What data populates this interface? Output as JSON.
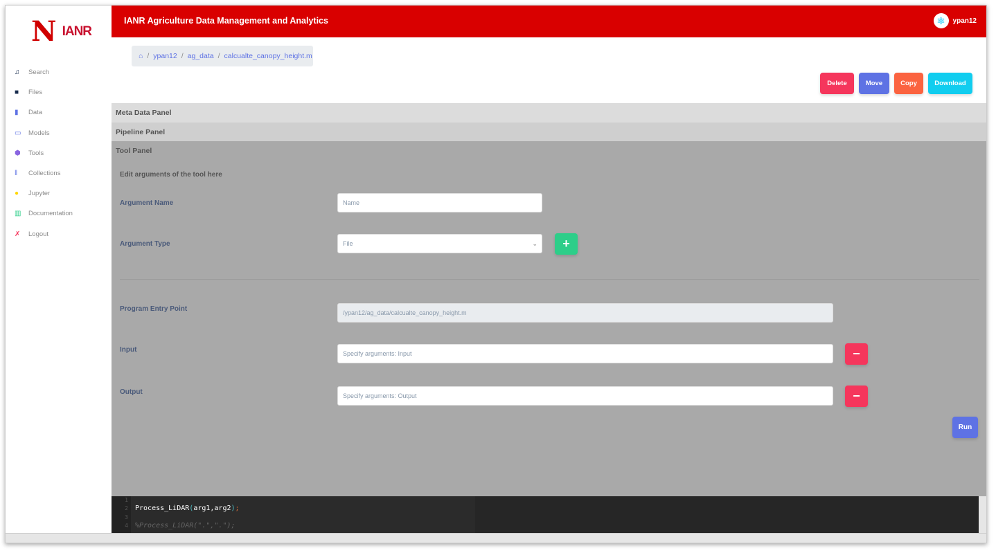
{
  "brand": {
    "logo_letter": "N",
    "logo_text": "IANR"
  },
  "sidebar": {
    "items": [
      {
        "label": "Search",
        "icon": "search-icon",
        "color": "#172b4d"
      },
      {
        "label": "Files",
        "icon": "files-icon",
        "color": "#172b4d"
      },
      {
        "label": "Data",
        "icon": "chart-bar-icon",
        "color": "#5e72e4"
      },
      {
        "label": "Models",
        "icon": "laptop-icon",
        "color": "#5e72e4"
      },
      {
        "label": "Tools",
        "icon": "box-icon",
        "color": "#8965e0"
      },
      {
        "label": "Collections",
        "icon": "collections-icon",
        "color": "#5e72e4"
      },
      {
        "label": "Jupyter",
        "icon": "user-icon",
        "color": "#ffd600"
      },
      {
        "label": "Documentation",
        "icon": "books-icon",
        "color": "#2dce89"
      },
      {
        "label": "Logout",
        "icon": "logout-icon",
        "color": "#f5365c"
      }
    ]
  },
  "header": {
    "title": "IANR Agriculture Data Management and Analytics",
    "user": "ypan12"
  },
  "breadcrumb": [
    "ypan12",
    "ag_data",
    "calcualte_canopy_height.m"
  ],
  "actions": {
    "delete": "Delete",
    "move": "Move",
    "copy": "Copy",
    "download": "Download"
  },
  "panels": {
    "meta": "Meta Data Panel",
    "pipeline": "Pipeline Panel",
    "tool": "Tool Panel"
  },
  "tool": {
    "subtitle": "Edit arguments of the tool here",
    "arg_name_label": "Argument Name",
    "arg_name_placeholder": "Name",
    "arg_type_label": "Argument Type",
    "arg_type_value": "File",
    "entry_label": "Program Entry Point",
    "entry_value": "/ypan12/ag_data/calcualte_canopy_height.m",
    "input_label": "Input",
    "input_placeholder": "Specify arguments: Input",
    "output_label": "Output",
    "output_placeholder": "Specify arguments: Output",
    "run": "Run"
  },
  "code": {
    "line_numbers": [
      "1",
      "2",
      "3",
      "4"
    ],
    "line2_fn": "Process_LiDAR",
    "line2_open": "(",
    "line2_args": "arg1,arg2",
    "line2_close": ")",
    "line2_end": ";",
    "line4": "%Process_LiDAR(\".\",\".\");"
  }
}
